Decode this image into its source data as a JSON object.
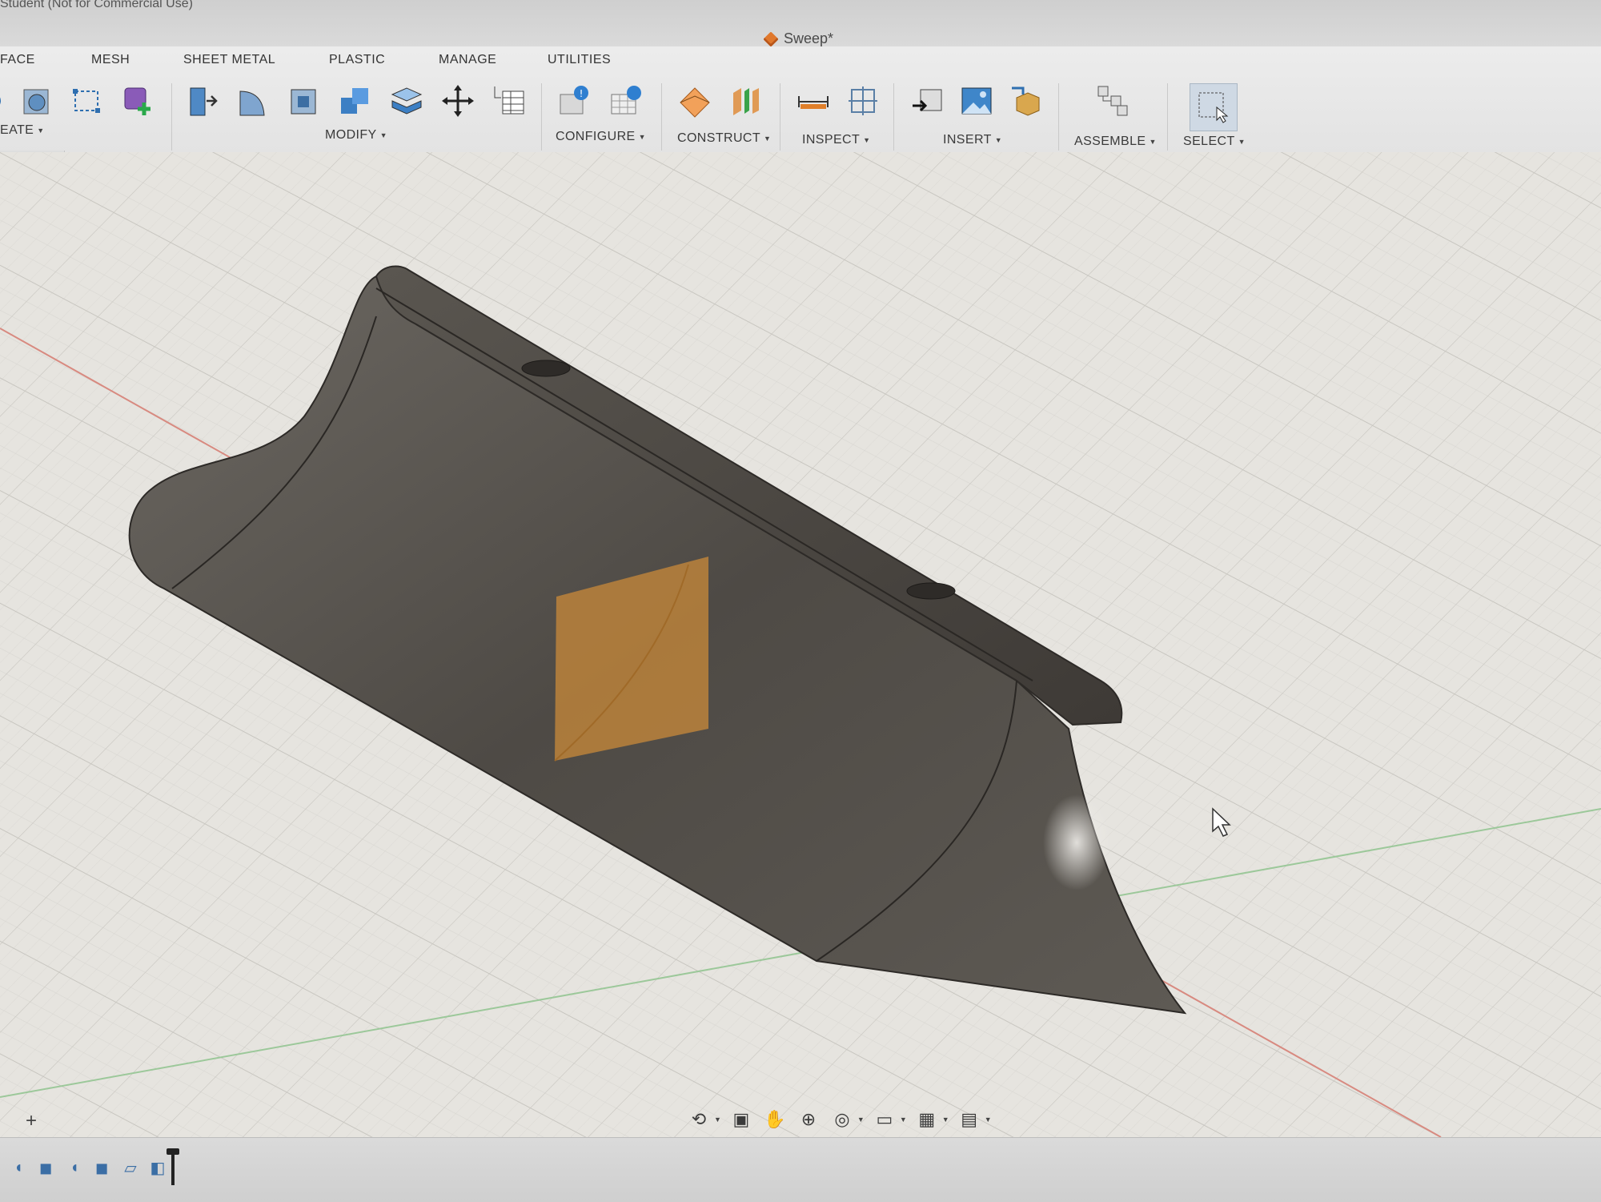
{
  "window": {
    "app_title": "Student (Not for Commercial Use)",
    "document_title": "Sweep*"
  },
  "ribbon": {
    "tabs": [
      "FACE",
      "MESH",
      "SHEET METAL",
      "PLASTIC",
      "MANAGE",
      "UTILITIES"
    ],
    "groups": {
      "create": "EATE",
      "modify": "MODIFY",
      "configure": "CONFIGURE",
      "construct": "CONSTRUCT",
      "inspect": "INSPECT",
      "insert": "INSERT",
      "assemble": "ASSEMBLE",
      "select": "SELECT"
    }
  },
  "browser": {
    "collapse_symbol": "–"
  },
  "viewport": {
    "add_symbol": "+",
    "colors": {
      "grid_background": "#e6e4df",
      "grid_line": "#cfcdc8",
      "model_body": "#5b5752",
      "sketch_profile": "#c98a3a",
      "axis_red": "#d88a80",
      "axis_green": "#9cc89a"
    }
  },
  "navigation": {
    "icons": [
      "orbit-icon",
      "look-at-icon",
      "pan-icon",
      "zoom-icon",
      "fit-icon",
      "display-settings-icon",
      "grid-icon",
      "viewports-icon"
    ]
  },
  "timeline": {
    "icons": [
      "sketch-icon",
      "extrude-icon",
      "sketch-icon",
      "extrude-icon",
      "plane-icon",
      "sweep-icon"
    ]
  }
}
